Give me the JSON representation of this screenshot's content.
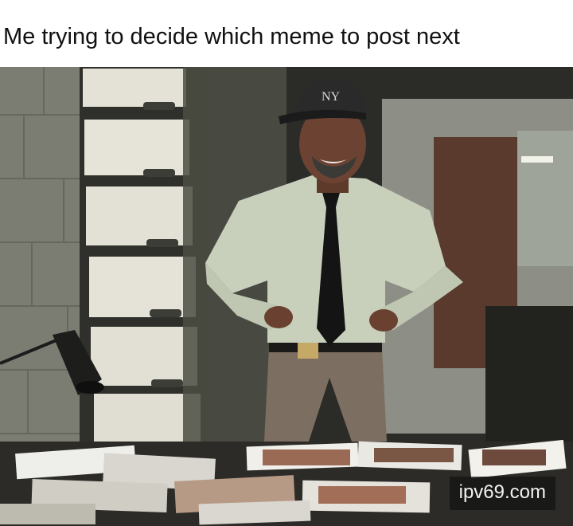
{
  "caption": "Me trying to decide which meme to post next",
  "watermark": "ipv69.com",
  "photo": {
    "subject": "man-in-cap-and-tie-smiling-over-desk-of-photos"
  },
  "colors": {
    "background": "#ffffff",
    "caption_text": "#111111",
    "watermark_bg": "#141414",
    "watermark_text": "#f2f2f2"
  }
}
